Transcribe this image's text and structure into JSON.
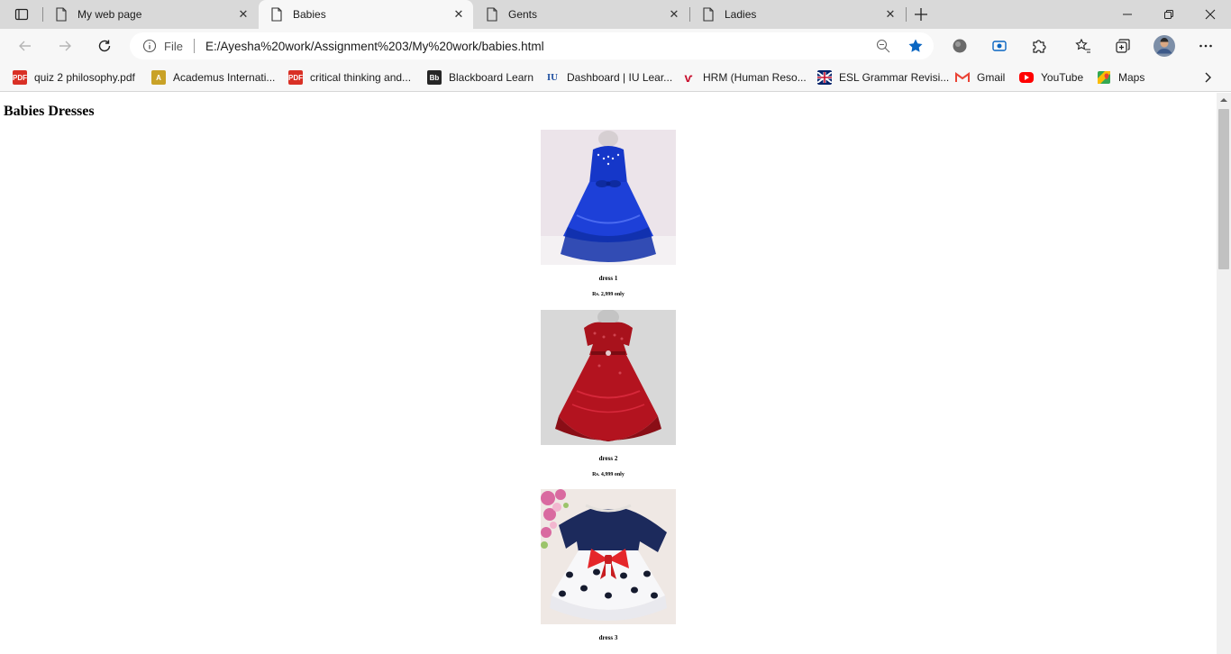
{
  "browser": {
    "tabs": [
      {
        "title": "My web page",
        "active": false
      },
      {
        "title": "Babies",
        "active": true
      },
      {
        "title": "Gents",
        "active": false
      },
      {
        "title": "Ladies",
        "active": false
      }
    ],
    "address": {
      "scheme_label": "File",
      "url": "E:/Ayesha%20work/Assignment%203/My%20work/babies.html"
    },
    "bookmarks": [
      {
        "label": "quiz 2 philosophy.pdf",
        "icon": "pdf-icon",
        "color": "#d93025"
      },
      {
        "label": "Academus Internati...",
        "icon": "academus-icon",
        "color": "#c9a227"
      },
      {
        "label": "critical thinking and...",
        "icon": "pdf-icon",
        "color": "#d93025"
      },
      {
        "label": "Blackboard Learn",
        "icon": "blackboard-icon",
        "color": "#262626"
      },
      {
        "label": "Dashboard | IU Lear...",
        "icon": "iu-icon",
        "color": "#1f4fa0"
      },
      {
        "label": "HRM (Human Reso...",
        "icon": "hrm-icon",
        "color": "#c8102e"
      },
      {
        "label": "ESL Grammar Revisi...",
        "icon": "uk-flag-icon",
        "color": "#012169"
      },
      {
        "label": "Gmail",
        "icon": "gmail-icon",
        "color": "#ea4335"
      },
      {
        "label": "YouTube",
        "icon": "youtube-icon",
        "color": "#ff0000"
      },
      {
        "label": "Maps",
        "icon": "maps-icon",
        "color": "#34a853"
      }
    ],
    "accent_color": "#0a66c2"
  },
  "page": {
    "heading": "Babies Dresses",
    "products": [
      {
        "name": "dress 1",
        "price": "Rs. 2,999 only",
        "dress_color": "#1537c9",
        "bg_color": "#ece4ea"
      },
      {
        "name": "dress 2",
        "price": "Rs. 4,999 only",
        "dress_color": "#b3131f",
        "bg_color": "#d8d8d8"
      },
      {
        "name": "dress 3",
        "price": "",
        "dress_color": "#1c2a5c",
        "bg_color": "#efe8e4"
      }
    ]
  }
}
